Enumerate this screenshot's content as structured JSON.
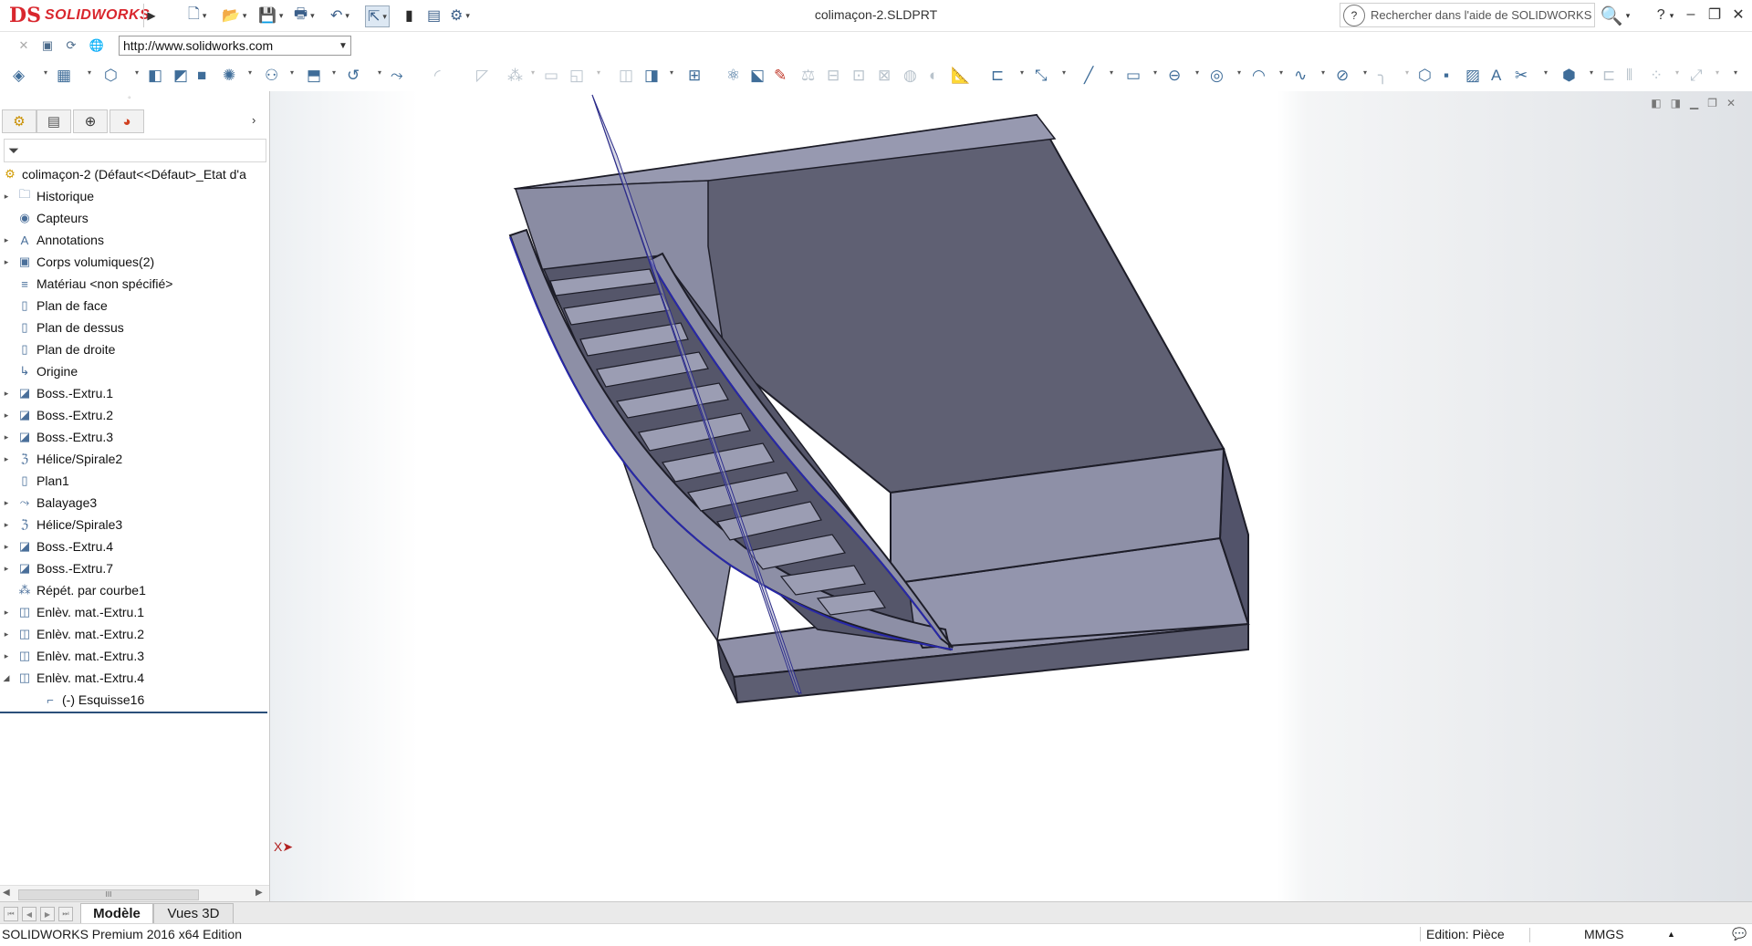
{
  "app": {
    "logo_mark": "DS",
    "logo_text": "SOLIDWORKS",
    "window_title": "colimaçon-2.SLDPRT"
  },
  "help": {
    "search_placeholder": "Rechercher dans l'aide de SOLIDWORKS",
    "help_glyph": "?"
  },
  "address": {
    "url": "http://www.solidworks.com"
  },
  "feature_tree": {
    "root": "colimaçon-2  (Défaut<<Défaut>_Etat d'a",
    "items": [
      {
        "label": "Historique",
        "icon": "history-folder-icon",
        "expandable": true
      },
      {
        "label": "Capteurs",
        "icon": "sensor-icon",
        "expandable": false
      },
      {
        "label": "Annotations",
        "icon": "annotation-icon",
        "expandable": true
      },
      {
        "label": "Corps volumiques(2)",
        "icon": "solid-bodies-icon",
        "expandable": true
      },
      {
        "label": "Matériau <non spécifié>",
        "icon": "material-icon",
        "expandable": false
      },
      {
        "label": "Plan de face",
        "icon": "plane-icon",
        "expandable": false
      },
      {
        "label": "Plan de dessus",
        "icon": "plane-icon",
        "expandable": false
      },
      {
        "label": "Plan de droite",
        "icon": "plane-icon",
        "expandable": false
      },
      {
        "label": "Origine",
        "icon": "origin-icon",
        "expandable": false
      },
      {
        "label": "Boss.-Extru.1",
        "icon": "extrude-icon",
        "expandable": true
      },
      {
        "label": "Boss.-Extru.2",
        "icon": "extrude-icon",
        "expandable": true
      },
      {
        "label": "Boss.-Extru.3",
        "icon": "extrude-icon",
        "expandable": true
      },
      {
        "label": "Hélice/Spirale2",
        "icon": "helix-icon",
        "expandable": true
      },
      {
        "label": "Plan1",
        "icon": "plane-icon",
        "expandable": false
      },
      {
        "label": "Balayage3",
        "icon": "sweep-icon",
        "expandable": true
      },
      {
        "label": "Hélice/Spirale3",
        "icon": "helix-icon",
        "expandable": true
      },
      {
        "label": "Boss.-Extru.4",
        "icon": "extrude-icon",
        "expandable": true
      },
      {
        "label": "Boss.-Extru.7",
        "icon": "extrude-icon",
        "expandable": true
      },
      {
        "label": "Répét. par courbe1",
        "icon": "curve-pattern-icon",
        "expandable": false
      },
      {
        "label": "Enlèv. mat.-Extru.1",
        "icon": "cut-extrude-icon",
        "expandable": true
      },
      {
        "label": "Enlèv. mat.-Extru.2",
        "icon": "cut-extrude-icon",
        "expandable": true
      },
      {
        "label": "Enlèv. mat.-Extru.3",
        "icon": "cut-extrude-icon",
        "expandable": true
      },
      {
        "label": "Enlèv. mat.-Extru.4",
        "icon": "cut-extrude-icon",
        "expandable": true,
        "expanded": true
      },
      {
        "label": "(-) Esquisse16",
        "icon": "sketch-icon",
        "expandable": false,
        "child": true
      }
    ]
  },
  "tabs": {
    "model": "Modèle",
    "views3d": "Vues 3D"
  },
  "status": {
    "left": "SOLIDWORKS Premium 2016 x64 Edition",
    "edit": "Edition: Pièce",
    "units": "MMGS"
  },
  "scrollbar": {
    "thumb_grip": "III"
  },
  "triad": {
    "x_label": "X"
  }
}
